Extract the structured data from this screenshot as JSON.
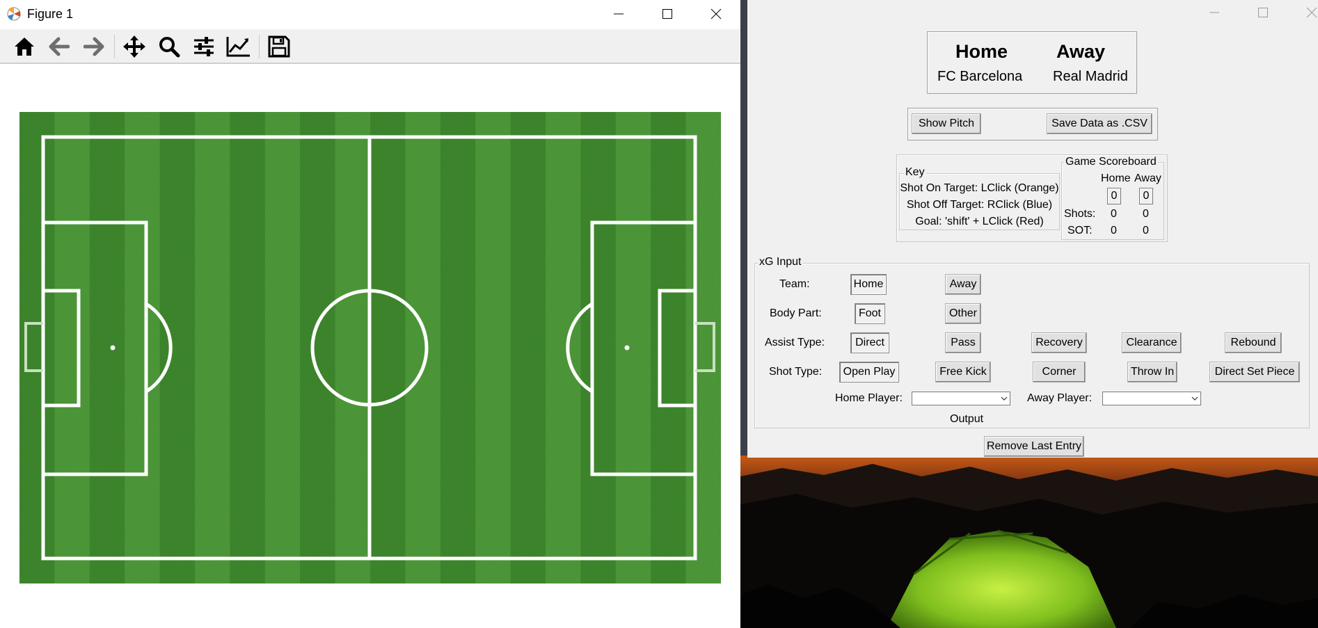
{
  "figure_window": {
    "title": "Figure 1",
    "toolbar": [
      "home-icon",
      "back-arrow-icon",
      "forward-arrow-icon",
      "pan-icon",
      "zoom-icon",
      "configure-subplots-icon",
      "edit-axis-icon",
      "save-icon"
    ]
  },
  "pitch": {
    "grass_dark": "#3f8a2e",
    "grass_light": "#4f9c3b",
    "line_color": "#ffffff"
  },
  "tk_window": {
    "teams": {
      "home_header": "Home",
      "away_header": "Away",
      "home_name": "FC Barcelona",
      "away_name": "Real Madrid"
    },
    "buttons": {
      "show_pitch": "Show Pitch",
      "save_csv": "Save Data as .CSV",
      "remove_last": "Remove Last Entry"
    },
    "key": {
      "label": "Key",
      "lines": [
        "Shot On Target: LClick (Orange)",
        "Shot Off Target: RClick (Blue)",
        "Goal: 'shift' + LClick (Red)"
      ]
    },
    "scoreboard": {
      "label": "Game Scoreboard",
      "home_col": "Home",
      "away_col": "Away",
      "home_goals": "0",
      "away_goals": "0",
      "shots_label": "Shots:",
      "home_shots": "0",
      "away_shots": "0",
      "sot_label": "SOT:",
      "home_sot": "0",
      "away_sot": "0"
    },
    "xg": {
      "label": "xG Input",
      "team_label": "Team:",
      "team_options": [
        "Home",
        "Away"
      ],
      "body_label": "Body Part:",
      "body_options": [
        "Foot",
        "Other"
      ],
      "assist_label": "Assist Type:",
      "assist_options": [
        "Direct",
        "Pass",
        "Recovery",
        "Clearance",
        "Rebound"
      ],
      "shot_label": "Shot Type:",
      "shot_options": [
        "Open Play",
        "Free Kick",
        "Corner",
        "Throw In",
        "Direct Set Piece"
      ],
      "home_player_label": "Home Player:",
      "away_player_label": "Away Player:",
      "home_player_value": "",
      "away_player_value": "",
      "output_label": "Output"
    }
  }
}
